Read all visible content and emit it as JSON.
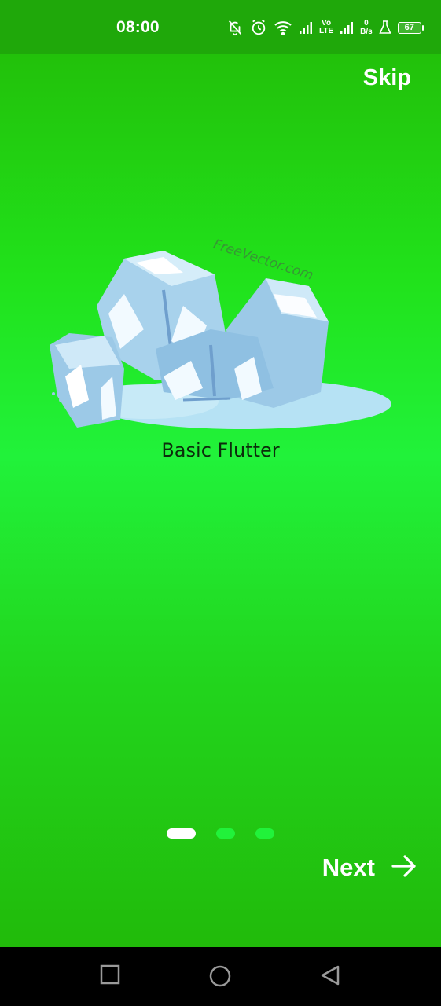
{
  "status_bar": {
    "time": "08:00",
    "network_type_top": "Vo",
    "network_type_bottom": "LTE",
    "data_speed_value": "0",
    "data_speed_unit": "B/s",
    "battery_level": "67",
    "icons": [
      "notifications-off-icon",
      "alarm-icon",
      "wifi-icon",
      "signal-icon",
      "signal-icon",
      "flask-icon",
      "battery-icon"
    ]
  },
  "onboarding": {
    "skip_label": "Skip",
    "image_watermark": "FreeVector.com",
    "slide_title": "Basic Flutter",
    "page_count": 3,
    "current_page": 1,
    "next_label": "Next",
    "next_icon": "arrow-right-icon"
  },
  "navigation_bar": {
    "buttons": [
      "recents-square-icon",
      "home-circle-icon",
      "back-triangle-icon"
    ]
  },
  "colors": {
    "status_bar": "#1fa80a",
    "screen_top": "#22c10a",
    "screen_mid": "#21f23a",
    "active_dot": "#ffffff",
    "inactive_dot": "#21f23a",
    "title_text": "#0c2d0c"
  }
}
